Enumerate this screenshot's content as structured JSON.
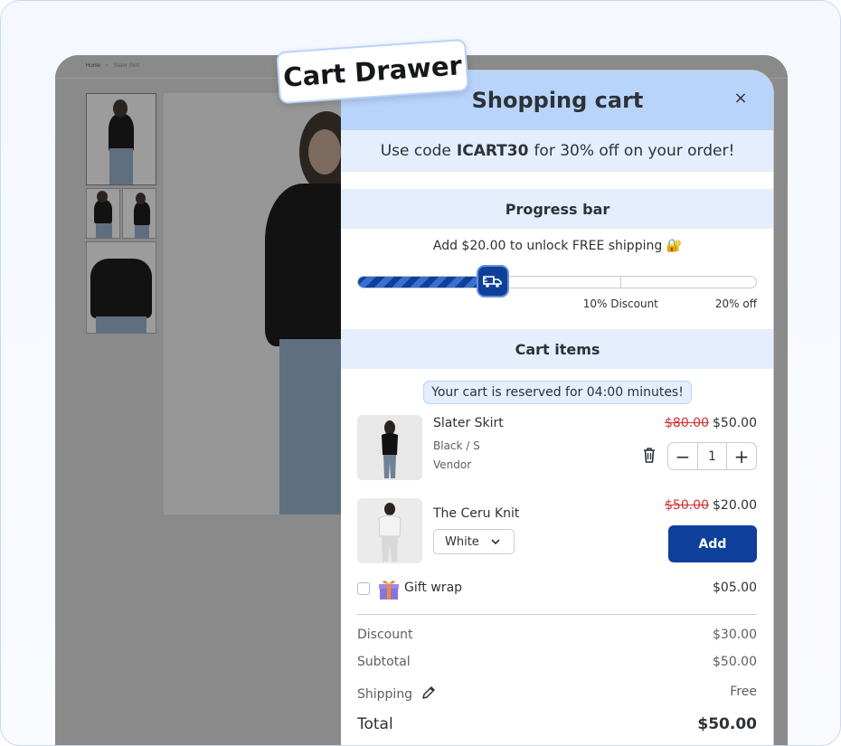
{
  "badge": {
    "label": "Cart Drawer"
  },
  "store": {
    "breadcrumb": {
      "home": "Home",
      "separator": "›",
      "current": "Slater Skirt"
    }
  },
  "drawer": {
    "title": "Shopping cart",
    "close_label": "×",
    "promo": {
      "prefix": "Use code",
      "code": "ICART30",
      "suffix": "for 30% off on your order!"
    },
    "progress_section": {
      "title": "Progress bar",
      "message": "Add $20.00 to unlock FREE shipping 🔐",
      "progress": 0.34,
      "milestones": [
        {
          "label": "10% Discount",
          "at": 0.66
        },
        {
          "label": "20% off",
          "at": 1.0
        }
      ],
      "knob_icon": "truck-icon"
    },
    "items_section": {
      "title": "Cart items",
      "reserve_notice": "Your cart is reserved for 04:00 minutes!"
    },
    "items": [
      {
        "name": "Slater Skirt",
        "variant": "Black / S",
        "vendor": "Vendor",
        "compare_price": "$80.00",
        "price": "$50.00",
        "quantity": "1",
        "qty_minus": "−",
        "qty_plus": "+"
      }
    ],
    "upsell": {
      "name": "The Ceru Knit",
      "variant": "White",
      "compare_price": "$50.00",
      "price": "$20.00",
      "button": "Add"
    },
    "gift_wrap": {
      "label": "Gift wrap",
      "price": "$05.00",
      "checked": false
    },
    "summary": [
      {
        "label": "Discount",
        "value": "$30.00"
      },
      {
        "label": "Subtotal",
        "value": "$50.00"
      },
      {
        "label": "Shipping",
        "value": "Free"
      },
      {
        "label": "Total",
        "value": "$50.00"
      }
    ]
  },
  "colors": {
    "header_bg": "#b9d4fb",
    "section_bg": "#e4eefc",
    "accent": "#0e3f9b",
    "strike": "#d33030"
  }
}
